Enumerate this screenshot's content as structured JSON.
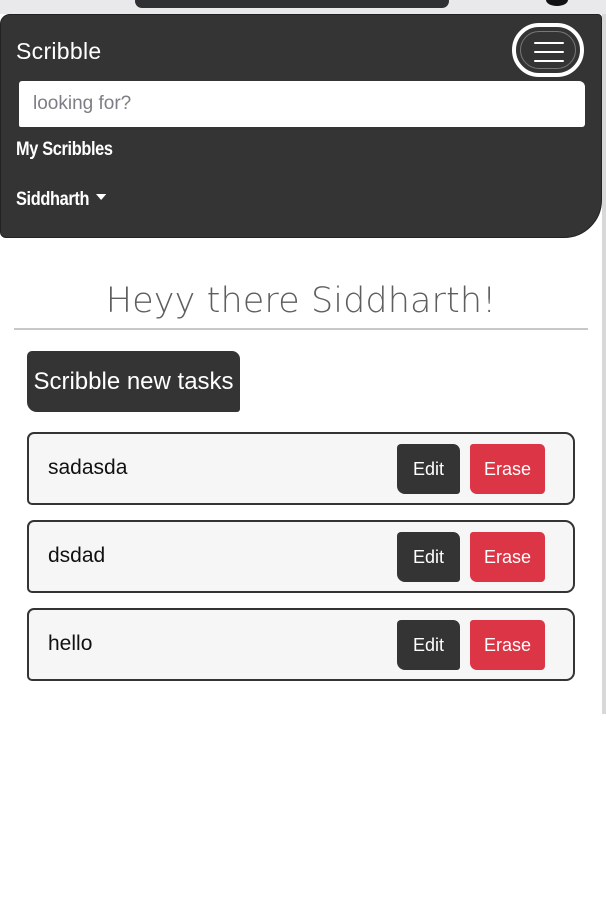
{
  "navbar": {
    "brand": "Scribble",
    "search_placeholder": "looking for?",
    "links": {
      "my_scribbles": "My Scribbles",
      "user": "Siddharth"
    },
    "icons": {
      "menu": "hamburger-icon",
      "user_menu": "caret-down-icon"
    }
  },
  "main": {
    "greeting": "Heyy there Siddharth!",
    "new_task_label": "Scribble new tasks",
    "tasks": [
      {
        "title": "sadasda",
        "edit_label": "Edit",
        "erase_label": "Erase"
      },
      {
        "title": "dsdad",
        "edit_label": "Edit",
        "erase_label": "Erase"
      },
      {
        "title": "hello",
        "edit_label": "Edit",
        "erase_label": "Erase"
      }
    ]
  },
  "colors": {
    "dark": "#343434",
    "danger": "#dc3545",
    "card": "#f6f6f6",
    "heading": "#5e5e5e"
  }
}
